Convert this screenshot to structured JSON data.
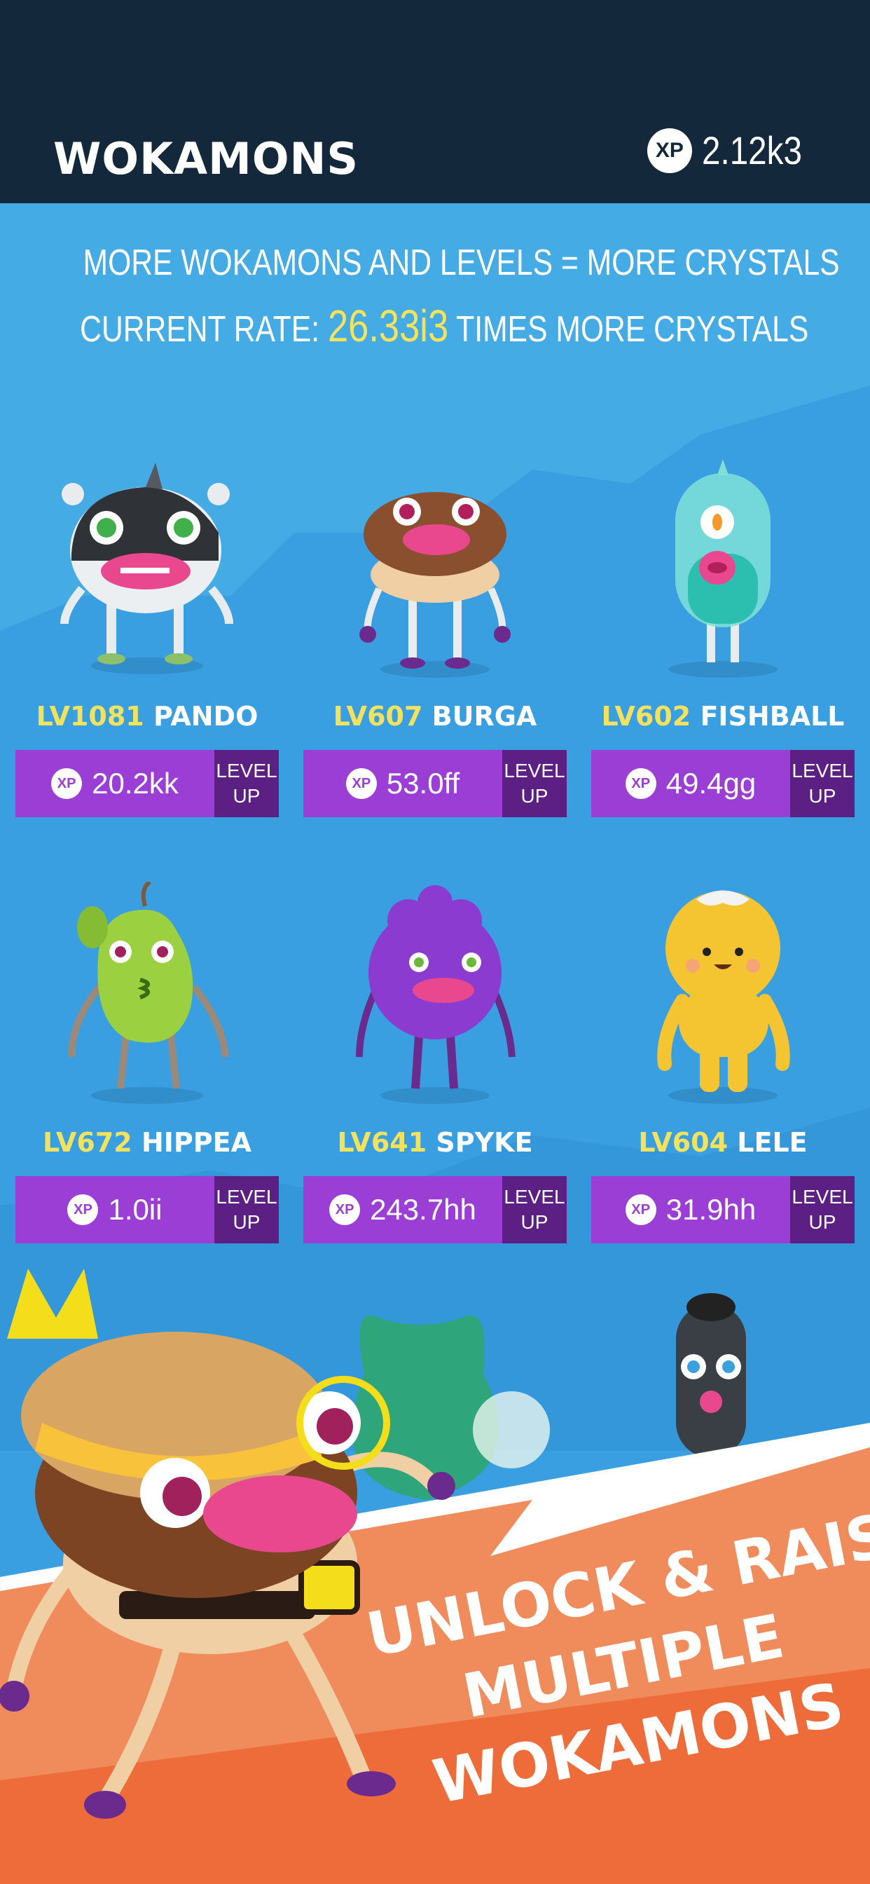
{
  "header": {
    "title": "WOKAMONS",
    "xp_badge": "XP",
    "xp_total": "2.12k3"
  },
  "info": {
    "line1": "MORE WOKAMONS AND LEVELS = MORE CRYSTALS",
    "rate_prefix": "CURRENT RATE:",
    "rate_value": "26.33i3",
    "rate_suffix": "TIMES MORE CRYSTALS"
  },
  "colors": {
    "header_bg": "#14283b",
    "sky": "#3a9fe0",
    "button_purple": "#9b3ed6",
    "button_dark": "#5c1f83",
    "level_yellow": "#f3e25d",
    "promo_orange": "#f07a4a"
  },
  "cards": [
    {
      "level": "LV1081",
      "name": "PANDO",
      "xp": "XP",
      "cost": "20.2kk",
      "btn_line1": "LEVEL",
      "btn_line2": "UP"
    },
    {
      "level": "LV607",
      "name": "BURGA",
      "xp": "XP",
      "cost": "53.0ff",
      "btn_line1": "LEVEL",
      "btn_line2": "UP"
    },
    {
      "level": "LV602",
      "name": "FISHBALL",
      "xp": "XP",
      "cost": "49.4gg",
      "btn_line1": "LEVEL",
      "btn_line2": "UP"
    },
    {
      "level": "LV672",
      "name": "HIPPEA",
      "xp": "XP",
      "cost": "1.0ii",
      "btn_line1": "LEVEL",
      "btn_line2": "UP"
    },
    {
      "level": "LV641",
      "name": "SPYKE",
      "xp": "XP",
      "cost": "243.7hh",
      "btn_line1": "LEVEL",
      "btn_line2": "UP"
    },
    {
      "level": "LV604",
      "name": "LELE",
      "xp": "XP",
      "cost": "31.9hh",
      "btn_line1": "LEVEL",
      "btn_line2": "UP"
    }
  ],
  "promo": {
    "line1": "UNLOCK & RAISE",
    "line2": "MULTIPLE",
    "line3": "WOKAMONS"
  }
}
